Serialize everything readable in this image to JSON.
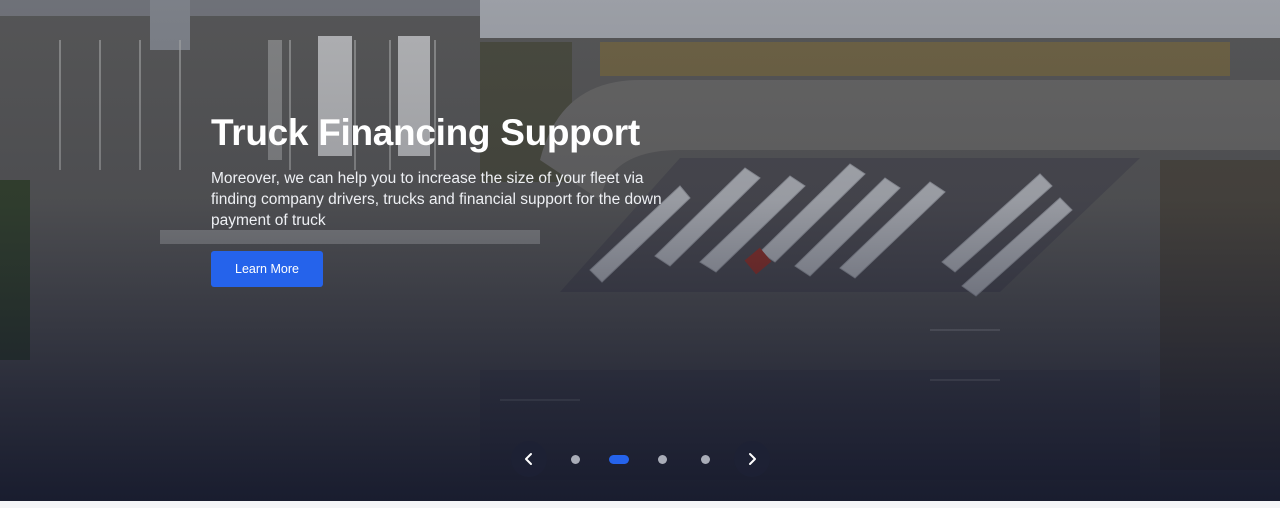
{
  "hero": {
    "title": "Truck Financing Support",
    "text": "Moreover, we can help you to increase the size of your fleet via finding company drivers, trucks and financial support for the down payment of truck",
    "button_label": "Learn More"
  },
  "carousel": {
    "prev_icon": "chevron-left-icon",
    "next_icon": "chevron-right-icon",
    "slide_count": 4,
    "active_slide": 2
  },
  "colors": {
    "accent": "#2563eb",
    "overlay": "#12162a"
  }
}
